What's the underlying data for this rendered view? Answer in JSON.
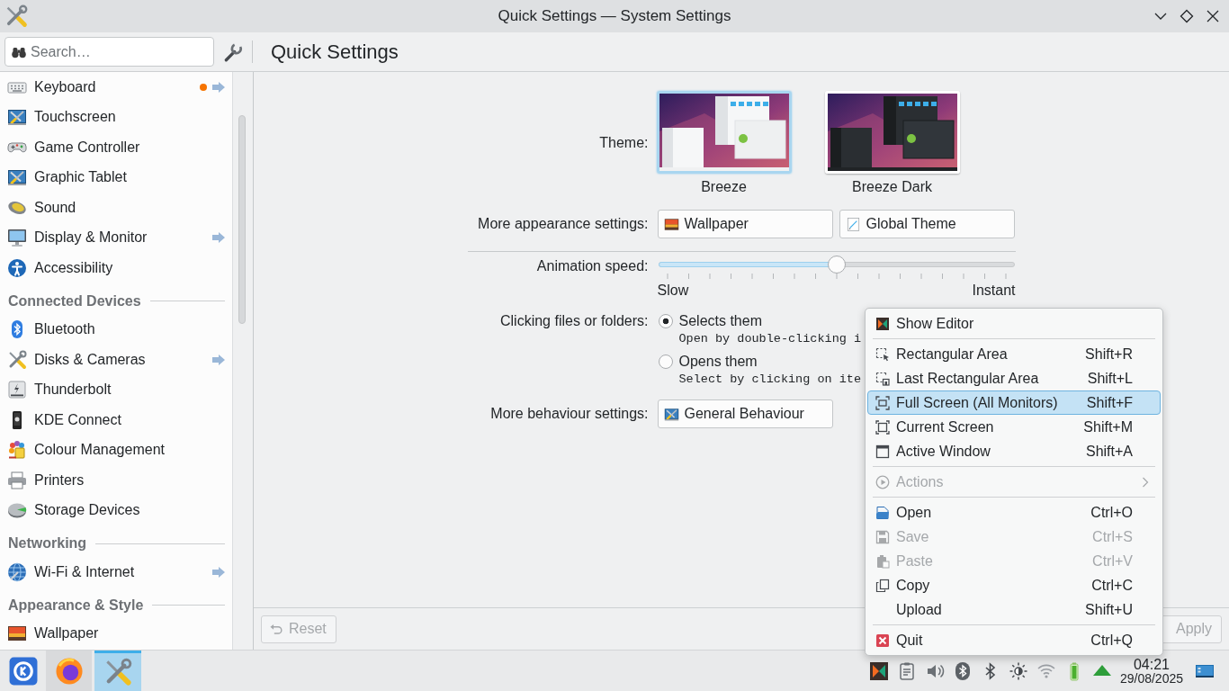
{
  "window": {
    "title": "Quick Settings — System Settings"
  },
  "search": {
    "placeholder": "Search…"
  },
  "page_title": "Quick Settings",
  "sidebar": {
    "items": [
      {
        "kind": "item",
        "label": "Keyboard",
        "selected": false,
        "modified": true,
        "subpages": true
      },
      {
        "kind": "item",
        "label": "Touchscreen",
        "selected": false,
        "modified": false,
        "subpages": false
      },
      {
        "kind": "item",
        "label": "Game Controller",
        "selected": false,
        "modified": false,
        "subpages": false
      },
      {
        "kind": "item",
        "label": "Graphic Tablet",
        "selected": false,
        "modified": false,
        "subpages": false
      },
      {
        "kind": "item",
        "label": "Sound",
        "selected": false,
        "modified": false,
        "subpages": false
      },
      {
        "kind": "item",
        "label": "Display & Monitor",
        "selected": false,
        "modified": false,
        "subpages": true
      },
      {
        "kind": "item",
        "label": "Accessibility",
        "selected": false,
        "modified": false,
        "subpages": false
      },
      {
        "kind": "header",
        "label": "Connected Devices"
      },
      {
        "kind": "item",
        "label": "Bluetooth",
        "selected": false,
        "modified": false,
        "subpages": false
      },
      {
        "kind": "item",
        "label": "Disks & Cameras",
        "selected": false,
        "modified": false,
        "subpages": true
      },
      {
        "kind": "item",
        "label": "Thunderbolt",
        "selected": false,
        "modified": false,
        "subpages": false
      },
      {
        "kind": "item",
        "label": "KDE Connect",
        "selected": false,
        "modified": false,
        "subpages": false
      },
      {
        "kind": "item",
        "label": "Colour Management",
        "selected": false,
        "modified": false,
        "subpages": false
      },
      {
        "kind": "item",
        "label": "Printers",
        "selected": false,
        "modified": false,
        "subpages": false
      },
      {
        "kind": "item",
        "label": "Storage Devices",
        "selected": false,
        "modified": false,
        "subpages": false
      },
      {
        "kind": "header",
        "label": "Networking"
      },
      {
        "kind": "item",
        "label": "Wi-Fi & Internet",
        "selected": false,
        "modified": false,
        "subpages": true
      },
      {
        "kind": "header",
        "label": "Appearance & Style"
      },
      {
        "kind": "item",
        "label": "Wallpaper",
        "selected": false,
        "modified": false,
        "subpages": false
      }
    ]
  },
  "theme": {
    "label": "Theme:",
    "options": [
      {
        "name": "Breeze",
        "kind": "light",
        "selected": true
      },
      {
        "name": "Breeze Dark",
        "kind": "dark",
        "selected": false
      }
    ]
  },
  "appearance": {
    "label": "More appearance settings:",
    "buttons": [
      "Wallpaper",
      "Global Theme"
    ]
  },
  "animation_speed": {
    "label": "Animation speed:",
    "level": 0.5,
    "min_label": "Slow",
    "max_label": "Instant"
  },
  "clicking": {
    "label": "Clicking files or folders:",
    "options": [
      {
        "label": "Selects them",
        "description": "Open by double-clicking i",
        "selected": true
      },
      {
        "label": "Opens them",
        "description": "Select by clicking on ite",
        "selected": false
      }
    ]
  },
  "behaviour": {
    "label": "More behaviour settings:",
    "buttons": [
      "General Behaviour"
    ]
  },
  "footer": {
    "buttons": [
      {
        "label": "Reset",
        "disabled": true
      },
      {
        "label": "Apply",
        "disabled": true
      }
    ]
  },
  "context_menu": {
    "items": [
      {
        "kind": "item",
        "label": "Show Editor",
        "selected": false,
        "disabled": false
      },
      {
        "kind": "separator"
      },
      {
        "kind": "item",
        "label": "Rectangular Area",
        "shortcut": "Shift+R",
        "selected": false,
        "disabled": false
      },
      {
        "kind": "item",
        "label": "Last Rectangular Area",
        "shortcut": "Shift+L",
        "selected": false,
        "disabled": false
      },
      {
        "kind": "item",
        "label": "Full Screen (All Monitors)",
        "shortcut": "Shift+F",
        "selected": true,
        "disabled": false
      },
      {
        "kind": "item",
        "label": "Current Screen",
        "shortcut": "Shift+M",
        "selected": false,
        "disabled": false
      },
      {
        "kind": "item",
        "label": "Active Window",
        "shortcut": "Shift+A",
        "selected": false,
        "disabled": false
      },
      {
        "kind": "separator"
      },
      {
        "kind": "submenu",
        "label": "Actions",
        "selected": false,
        "disabled": true
      },
      {
        "kind": "separator"
      },
      {
        "kind": "item",
        "label": "Open",
        "shortcut": "Ctrl+O",
        "selected": false,
        "disabled": false
      },
      {
        "kind": "item",
        "label": "Save",
        "shortcut": "Ctrl+S",
        "selected": false,
        "disabled": true
      },
      {
        "kind": "item",
        "label": "Paste",
        "shortcut": "Ctrl+V",
        "selected": false,
        "disabled": true
      },
      {
        "kind": "item",
        "label": "Copy",
        "shortcut": "Ctrl+C",
        "selected": false,
        "disabled": false
      },
      {
        "kind": "item",
        "label": "Upload",
        "shortcut": "Shift+U",
        "selected": false,
        "disabled": false
      },
      {
        "kind": "separator"
      },
      {
        "kind": "item",
        "label": "Quit",
        "shortcut": "Ctrl+Q",
        "selected": false,
        "disabled": false
      }
    ]
  },
  "taskbar": {
    "tasks": [
      {
        "selected": false
      },
      {
        "selected": true
      }
    ],
    "clock": {
      "time": "04:21",
      "date": "29/08/2025"
    }
  }
}
